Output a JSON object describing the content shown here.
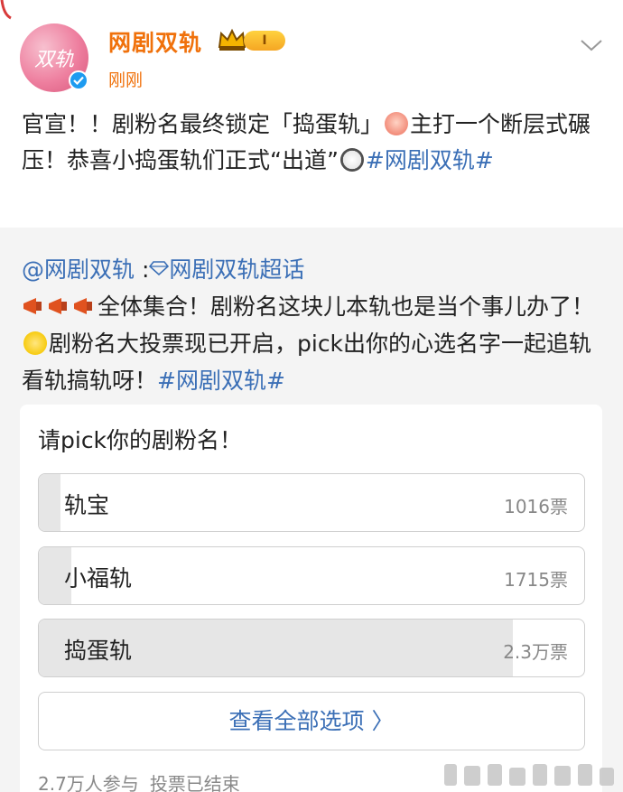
{
  "post": {
    "author": "网剧双轨",
    "level_badge": "I",
    "timestamp": "刚刚",
    "avatar_text": "双轨",
    "text_parts": [
      "官宣！！剧粉名最终锁定「捣蛋轨」",
      "主打一个断层式碾压！恭喜小捣蛋轨们正式“出道”",
      "#网剧双轨#"
    ]
  },
  "repost": {
    "mention": "@网剧双轨",
    "colon": " :",
    "supertopic": "网剧双轨超话",
    "text_a": "全体集合！剧粉名这块儿本轨也是当个事儿办了！",
    "text_b": "剧粉名大投票现已开启，pick出你的心选名字一起追轨看轨搞轨呀！",
    "hashtag": "#网剧双轨#"
  },
  "poll": {
    "title": "请pick你的剧粉名！",
    "options": [
      {
        "label": "轨宝",
        "votes": "1016票",
        "share": 0.04
      },
      {
        "label": "小福轨",
        "votes": "1715票",
        "share": 0.06
      },
      {
        "label": "捣蛋轨",
        "votes": "2.3万票",
        "share": 0.87
      }
    ],
    "view_all": "查看全部选项 〉",
    "participants": "2.7万人参与",
    "status": "投票已结束"
  },
  "colors": {
    "accent_orange": "#f0710b",
    "link_blue": "#3b6fb6",
    "repost_bg": "#f4f4f4"
  },
  "icons": [
    "verified-icon",
    "crown-icon",
    "chevron-down-icon",
    "diamond-icon",
    "megaphone-icon",
    "egg-emoji-icon",
    "cat-emoji-icon",
    "glasses-emoji-icon"
  ]
}
